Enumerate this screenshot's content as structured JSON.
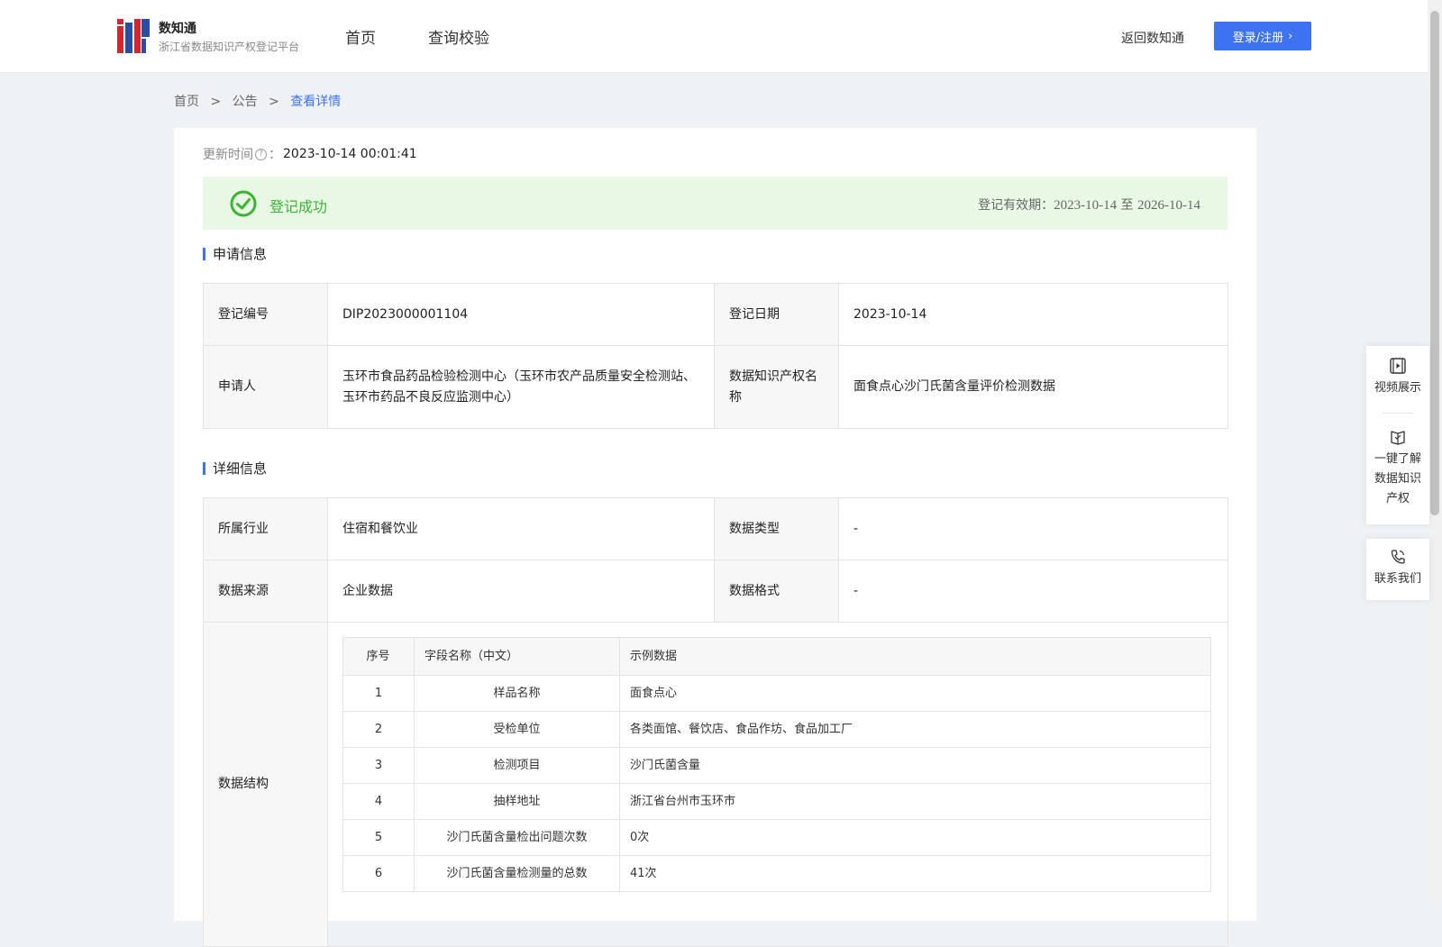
{
  "header": {
    "logo_title": "数知通",
    "logo_subtitle": "浙江省数据知识产权登记平台",
    "nav": [
      "首页",
      "查询校验"
    ],
    "back_link": "返回数知通",
    "login_label": "登录/注册"
  },
  "breadcrumb": {
    "items": [
      "首页",
      "公告"
    ],
    "current": "查看详情",
    "separator": ">"
  },
  "detail": {
    "update_label": "更新时间",
    "update_colon": "：",
    "update_value": "2023-10-14 00:01:41",
    "status_text": "登记成功",
    "validity_label": "登记有效期：",
    "validity_from": "2023-10-14",
    "validity_to_word": "至",
    "validity_to": "2026-10-14"
  },
  "application": {
    "title": "申请信息",
    "reg_no_label": "登记编号",
    "reg_no_value": "DIP2023000001104",
    "reg_date_label": "登记日期",
    "reg_date_value": "2023-10-14",
    "applicant_label": "申请人",
    "applicant_value": "玉环市食品药品检验检测中心（玉环市农产品质量安全检测站、玉环市药品不良反应监测中心）",
    "ip_name_label": "数据知识产权名称",
    "ip_name_value": "面食点心沙门氏菌含量评价检测数据"
  },
  "details_info": {
    "title": "详细信息",
    "industry_label": "所属行业",
    "industry_value": "住宿和餐饮业",
    "data_type_label": "数据类型",
    "data_type_value": "-",
    "source_label": "数据来源",
    "source_value": "企业数据",
    "format_label": "数据格式",
    "format_value": "-",
    "structure_label": "数据结构"
  },
  "structure_table": {
    "headers": [
      "序号",
      "字段名称（中文）",
      "示例数据"
    ],
    "rows": [
      [
        "1",
        "样品名称",
        "面食点心"
      ],
      [
        "2",
        "受检单位",
        "各类面馆、餐饮店、食品作坊、食品加工厂"
      ],
      [
        "3",
        "检测项目",
        "沙门氏菌含量"
      ],
      [
        "4",
        "抽样地址",
        "浙江省台州市玉环市"
      ],
      [
        "5",
        "沙门氏菌含量检出问题次数",
        "0次"
      ],
      [
        "6",
        "沙门氏菌含量检测量的总数",
        "41次"
      ]
    ]
  },
  "float_panel": {
    "video": "视频展示",
    "learn_line1": "一键了解",
    "learn_line2": "数据知识",
    "learn_line3": "产权",
    "contact": "联系我们"
  },
  "colors": {
    "primary": "#3d73f0",
    "success": "#3cb534",
    "success_bg": "#e9f8e5",
    "page_bg": "#eef2f5"
  }
}
